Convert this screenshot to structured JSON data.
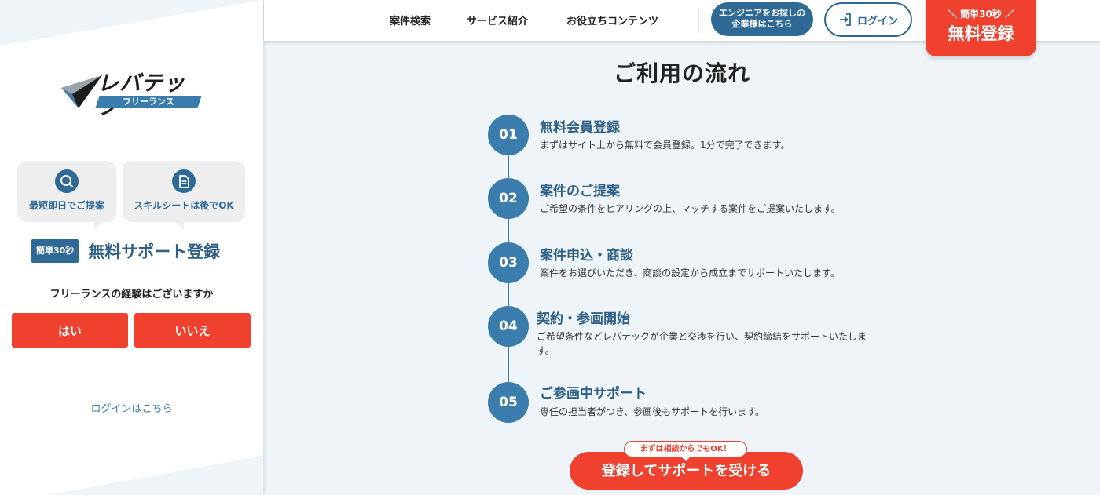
{
  "sidebar": {
    "logo_text": "レバテック",
    "logo_sub": "フリーランス",
    "features": [
      {
        "icon": "search-icon",
        "label": "最短即日でご提案"
      },
      {
        "icon": "document-icon",
        "label": "スキルシートは後でOK"
      }
    ],
    "support_badge": "簡単30秒",
    "support_title": "無料サポート登録",
    "question": "フリーランスの経験はございますか",
    "yes_label": "はい",
    "no_label": "いいえ",
    "login_link": "ログインはこちら"
  },
  "header": {
    "nav": [
      "案件検索",
      "サービス紹介",
      "お役立ちコンテンツ"
    ],
    "enterprise_line1": "エンジニアをお探しの",
    "enterprise_line2": "企業様はこちら",
    "login_label": "ログイン",
    "register_small": "＼ 簡単30秒 ／",
    "register_big": "無料登録"
  },
  "main": {
    "title": "ご利用の流れ",
    "steps": [
      {
        "num": "01",
        "title": "無料会員登録",
        "desc": "まずはサイト上から無料で会員登録。1分で完了できます。"
      },
      {
        "num": "02",
        "title": "案件のご提案",
        "desc": "ご希望の条件をヒアリングの上、マッチする案件をご提案いたします。"
      },
      {
        "num": "03",
        "title": "案件申込・商談",
        "desc": "案件をお選びいただき、商談の設定から成立までサポートいたします。"
      },
      {
        "num": "04",
        "title": "契約・参画開始",
        "desc": "ご希望条件などレバテックが企業と交渉を行い、契約締結をサポートいたします。"
      },
      {
        "num": "05",
        "title": "ご参画中サポート",
        "desc": "専任の担当者がつき、参画後もサポートを行います。"
      }
    ],
    "cta_tag": "まずは相談からでもOK！",
    "cta_label": "登録してサポートを受ける"
  },
  "colors": {
    "accent_red": "#f0412f",
    "brand_blue": "#2f6a97",
    "step_blue": "#3a7dad",
    "background": "#eef4f8"
  }
}
